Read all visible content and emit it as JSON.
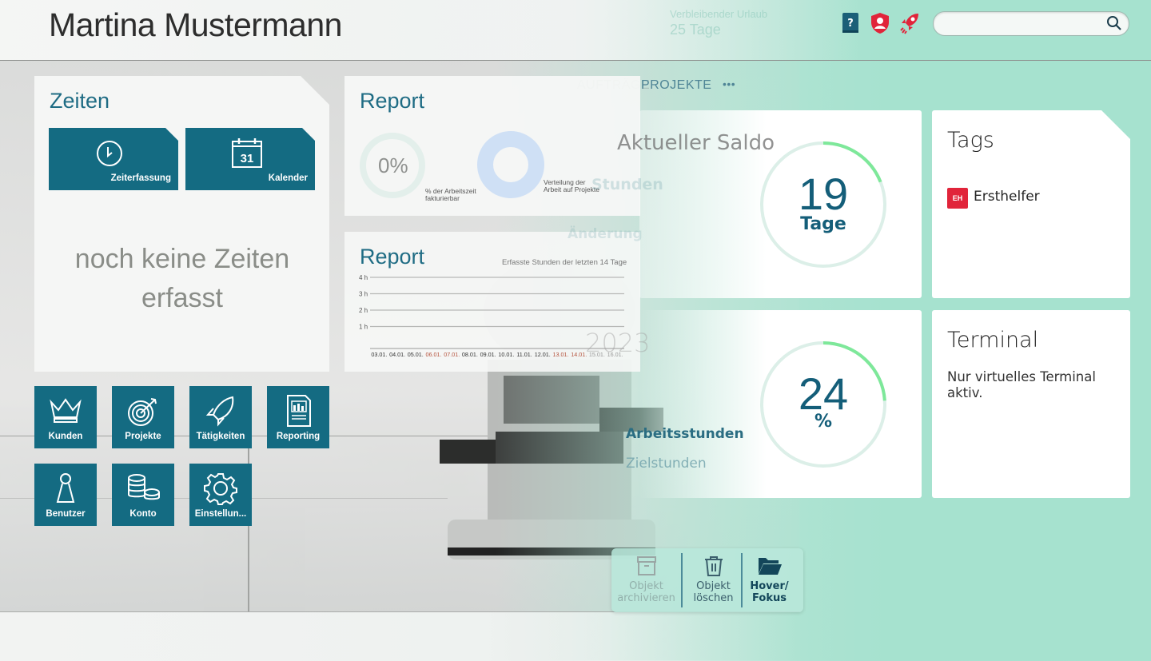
{
  "header": {
    "user_name": "Martina Mustermann",
    "ghost_label": "Verbleibender Urlaub",
    "ghost_value": "25 Tage",
    "icons": [
      "help-book-icon",
      "user-shield-icon",
      "rocket-icon",
      "search-icon"
    ],
    "search": {
      "value": "",
      "placeholder": ""
    }
  },
  "zeiten": {
    "title": "Zeiten",
    "tiles": [
      {
        "label": "Zeiterfassung",
        "icon": "clock-icon"
      },
      {
        "label": "Kalender",
        "icon": "calendar-icon",
        "day": "31"
      }
    ],
    "empty_line1": "noch keine Zeiten",
    "empty_line2": "erfasst"
  },
  "nav_tiles": [
    {
      "label": "Kunden",
      "icon": "crown-icon"
    },
    {
      "label": "Projekte",
      "icon": "target-icon"
    },
    {
      "label": "Tätigkeiten",
      "icon": "rocket-icon"
    },
    {
      "label": "Reporting",
      "icon": "report-icon"
    },
    {
      "label": "Benutzer",
      "icon": "user-pawn-icon"
    },
    {
      "label": "Konto",
      "icon": "coins-icon"
    },
    {
      "label": "Einstellun...",
      "icon": "gear-icon"
    }
  ],
  "report1": {
    "title": "Report",
    "billable_percent_label": "0%",
    "billable_percent": 0,
    "billable_caption": "% der Arbeitszeit fakturierbar",
    "distribution_caption": "Verteilung der Arbeit auf Projekte"
  },
  "report2": {
    "title": "Report",
    "subtitle": "Erfasste Stunden der letzten 14 Tage"
  },
  "chart_data": {
    "type": "bar",
    "title": "Erfasste Stunden der letzten 14 Tage",
    "xlabel": "",
    "ylabel": "",
    "categories": [
      "03.01.",
      "04.01.",
      "05.01.",
      "06.01.",
      "07.01.",
      "08.01.",
      "09.01.",
      "10.01.",
      "11.01.",
      "12.01.",
      "13.01.",
      "14.01.",
      "15.01.",
      "16.01."
    ],
    "weekend_categories": [
      "06.01.",
      "07.01.",
      "13.01.",
      "14.01."
    ],
    "future_categories": [
      "15.01.",
      "16.01."
    ],
    "values": [
      0,
      0,
      0,
      0,
      0,
      0,
      0,
      0,
      0,
      0,
      0,
      0,
      0,
      0
    ],
    "yticks": [
      "1 h",
      "2 h",
      "3 h",
      "4 h"
    ],
    "ylim": [
      0,
      4
    ],
    "grid": true
  },
  "tabs": {
    "items": [
      {
        "label": "AUFTRÄGE"
      },
      {
        "label": "PROJEKTE"
      }
    ],
    "more_label": "•••"
  },
  "saldo": {
    "ghost_title": "Aktueller Saldo",
    "ghost_sub1": "Stunden",
    "ghost_sub2": "Änderung",
    "value": "19",
    "unit": "Tage",
    "progress": 0.19
  },
  "hours": {
    "ghost_year": "2023",
    "ghost_worked": "Arbeitsstunden",
    "ghost_target": "Zielstunden",
    "value": "24",
    "unit": "%",
    "progress": 0.24
  },
  "tags": {
    "title": "Tags",
    "items": [
      {
        "badge": "EH",
        "name": "Ersthelfer",
        "color": "#e1243a"
      }
    ]
  },
  "terminal": {
    "title": "Terminal",
    "text": "Nur virtuelles Terminal aktiv."
  },
  "actions": [
    {
      "line1": "Objekt",
      "line2": "archivieren",
      "icon": "archive-box-icon",
      "state": "disabled"
    },
    {
      "line1": "Objekt",
      "line2": "löschen",
      "icon": "trash-icon",
      "state": "normal"
    },
    {
      "line1": "Hover/",
      "line2": "Fokus",
      "icon": "folder-open-icon",
      "state": "focus"
    }
  ],
  "colors": {
    "accent": "#146b82",
    "ring_progress": "#7ee89a",
    "ring_track": "#dcefe8",
    "alert": "#e1243a",
    "weekend": "#b5523c"
  }
}
